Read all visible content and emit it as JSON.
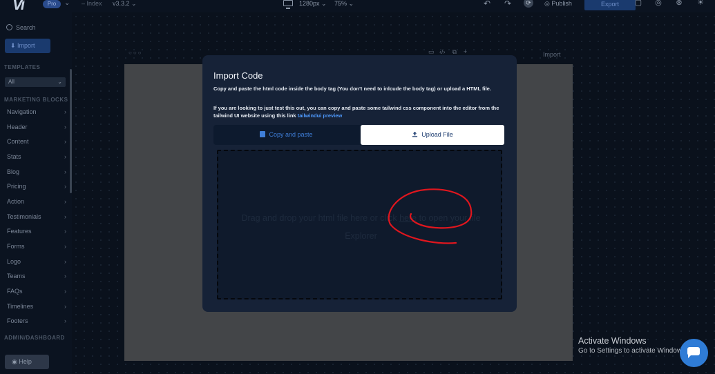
{
  "topbar": {
    "logo": "Vi",
    "plan_badge": "Pro",
    "page_select": "Index",
    "version": "v3.3.2",
    "width_select": "1280px",
    "zoom_select": "75%",
    "publish_label": "Publish",
    "export_label": "Export"
  },
  "sidebar": {
    "search_label": "Search",
    "import_label": "Import",
    "templates_heading": "TEMPLATES",
    "templates_select": "All",
    "marketing_heading": "MARKETING BLOCKS",
    "items": [
      "Navigation",
      "Header",
      "Content",
      "Stats",
      "Blog",
      "Pricing",
      "Action",
      "Testimonials",
      "Features",
      "Forms",
      "Logo",
      "Teams",
      "FAQs",
      "Timelines",
      "Footers"
    ],
    "admin_heading": "ADMIN/DASHBOARD",
    "help_label": "Help"
  },
  "canvas": {
    "import_label": "Import"
  },
  "modal": {
    "title": "Import Code",
    "desc_1": "Copy and paste the html code inside the body tag (You don't need to inlcude the body tag) or upload a HTML file.",
    "desc_2": "If you are looking to just test this out, you can copy and paste some tailwind css component into the editor from the tailwind UI website using this link",
    "desc_link": "tailwindui preview",
    "tab_copy": "Copy and paste",
    "tab_upload": "Upload File",
    "drop_before": "Drag and drop your html file here or click",
    "drop_link": "here",
    "drop_after": "to open your file Explorer"
  },
  "watermark": {
    "line1": "Activate Windows",
    "line2": "Go to Settings to activate Windows."
  },
  "colors": {
    "accent": "#2f7cd6",
    "modal_bg": "#162237",
    "annotation": "#e0161e"
  }
}
